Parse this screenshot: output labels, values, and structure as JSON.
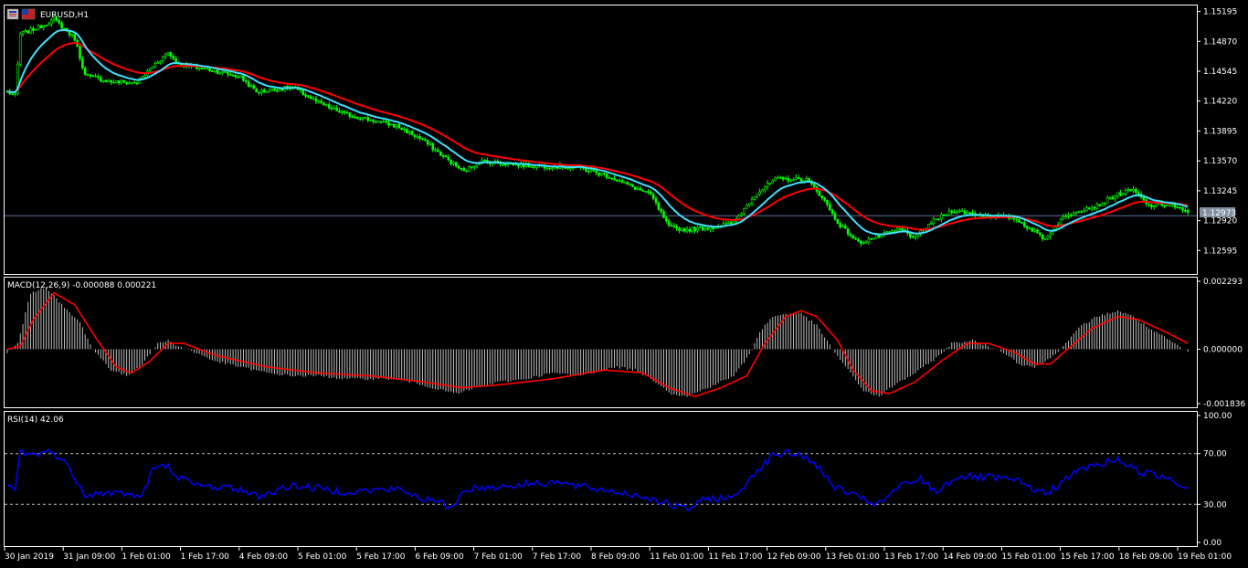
{
  "window": {
    "symbol_label": "EURUSD,H1",
    "macd_label": "MACD(12,26,9) -0.000088 0.000221",
    "rsi_label": "RSI(14) 42.06",
    "current_price": "1.12973"
  },
  "colors": {
    "background": "#000000",
    "frame": "#ffffff",
    "candle": "#00ff00",
    "ma_fast": "#40e0ff",
    "ma_slow": "#ff0000",
    "macd_hist": "#c0c0c0",
    "macd_signal": "#ff0000",
    "rsi_line": "#0000ff",
    "price_line": "#6070a0",
    "level_line": "#c0c0c0",
    "price_tag_bg": "#8090a0"
  },
  "chart_data": [
    {
      "type": "candlestick",
      "symbol": "EURUSD",
      "timeframe": "H1",
      "y_ticks": [
        "1.15195",
        "1.14870",
        "1.14545",
        "1.14220",
        "1.13895",
        "1.13570",
        "1.13245",
        "1.12920",
        "1.12595"
      ],
      "ylim": [
        1.1234,
        1.1526
      ],
      "current_price": 1.12973,
      "close_keypoints": [
        [
          0,
          1.1432
        ],
        [
          3,
          1.1428
        ],
        [
          5,
          1.1495
        ],
        [
          12,
          1.1502
        ],
        [
          18,
          1.1511
        ],
        [
          23,
          1.1498
        ],
        [
          26,
          1.149
        ],
        [
          30,
          1.145
        ],
        [
          40,
          1.1443
        ],
        [
          50,
          1.1442
        ],
        [
          56,
          1.146
        ],
        [
          62,
          1.1475
        ],
        [
          66,
          1.1462
        ],
        [
          80,
          1.1455
        ],
        [
          90,
          1.1448
        ],
        [
          96,
          1.1432
        ],
        [
          110,
          1.1437
        ],
        [
          120,
          1.142
        ],
        [
          130,
          1.1408
        ],
        [
          150,
          1.1395
        ],
        [
          160,
          1.138
        ],
        [
          168,
          1.1362
        ],
        [
          176,
          1.1345
        ],
        [
          182,
          1.1357
        ],
        [
          200,
          1.1352
        ],
        [
          220,
          1.135
        ],
        [
          232,
          1.134
        ],
        [
          248,
          1.132
        ],
        [
          255,
          1.1285
        ],
        [
          262,
          1.1282
        ],
        [
          272,
          1.1285
        ],
        [
          280,
          1.129
        ],
        [
          288,
          1.132
        ],
        [
          296,
          1.1337
        ],
        [
          308,
          1.1337
        ],
        [
          314,
          1.1318
        ],
        [
          320,
          1.129
        ],
        [
          328,
          1.1268
        ],
        [
          336,
          1.1275
        ],
        [
          344,
          1.1283
        ],
        [
          350,
          1.1273
        ],
        [
          356,
          1.129
        ],
        [
          364,
          1.1303
        ],
        [
          376,
          1.1298
        ],
        [
          388,
          1.1295
        ],
        [
          396,
          1.128
        ],
        [
          400,
          1.1272
        ],
        [
          406,
          1.1293
        ],
        [
          412,
          1.1303
        ],
        [
          420,
          1.1308
        ],
        [
          428,
          1.1321
        ],
        [
          434,
          1.1325
        ],
        [
          440,
          1.1308
        ],
        [
          448,
          1.131
        ],
        [
          455,
          1.13
        ]
      ],
      "series": [
        {
          "name": "",
          "kind": "moving-average-fast"
        },
        {
          "name": "",
          "kind": "moving-average-slow"
        }
      ]
    },
    {
      "type": "macd",
      "title": "MACD(12,26,9) -0.000088 0.000221",
      "y_ticks": [
        "0.002293",
        "0.000000",
        "-0.001836"
      ],
      "ylim": [
        -0.001836,
        0.002293
      ],
      "hist_keypoints": [
        [
          0,
          -0.0001
        ],
        [
          4,
          0.0002
        ],
        [
          9,
          0.0019
        ],
        [
          15,
          0.0021
        ],
        [
          22,
          0.0014
        ],
        [
          28,
          0.0009
        ],
        [
          33,
          0.0
        ],
        [
          40,
          -0.0007
        ],
        [
          46,
          -0.0009
        ],
        [
          52,
          -0.0005
        ],
        [
          58,
          0.0002
        ],
        [
          62,
          0.0003
        ],
        [
          66,
          0.0001
        ],
        [
          72,
          -0.0001
        ],
        [
          80,
          -0.0004
        ],
        [
          90,
          -0.0006
        ],
        [
          100,
          -0.0008
        ],
        [
          110,
          -0.0009
        ],
        [
          120,
          -0.0009
        ],
        [
          130,
          -0.001
        ],
        [
          140,
          -0.001
        ],
        [
          150,
          -0.001
        ],
        [
          160,
          -0.0012
        ],
        [
          168,
          -0.0014
        ],
        [
          174,
          -0.0015
        ],
        [
          180,
          -0.0013
        ],
        [
          190,
          -0.0011
        ],
        [
          200,
          -0.001
        ],
        [
          210,
          -0.0008
        ],
        [
          220,
          -0.0009
        ],
        [
          235,
          -0.0006
        ],
        [
          242,
          -0.0007
        ],
        [
          250,
          -0.0011
        ],
        [
          256,
          -0.0015
        ],
        [
          262,
          -0.0016
        ],
        [
          270,
          -0.0013
        ],
        [
          280,
          -0.0009
        ],
        [
          286,
          -0.0002
        ],
        [
          290,
          0.0006
        ],
        [
          295,
          0.0011
        ],
        [
          300,
          0.0012
        ],
        [
          306,
          0.0012
        ],
        [
          312,
          0.0008
        ],
        [
          318,
          0.0
        ],
        [
          324,
          -0.0007
        ],
        [
          330,
          -0.0014
        ],
        [
          336,
          -0.0016
        ],
        [
          342,
          -0.0012
        ],
        [
          350,
          -0.0008
        ],
        [
          358,
          -0.0003
        ],
        [
          364,
          0.0002
        ],
        [
          372,
          0.0003
        ],
        [
          378,
          0.0001
        ],
        [
          384,
          -0.0001
        ],
        [
          390,
          -0.0005
        ],
        [
          396,
          -0.0006
        ],
        [
          402,
          -0.0003
        ],
        [
          408,
          0.0002
        ],
        [
          414,
          0.0008
        ],
        [
          420,
          0.0011
        ],
        [
          428,
          0.0013
        ],
        [
          434,
          0.0011
        ],
        [
          440,
          0.0007
        ],
        [
          448,
          0.0003
        ],
        [
          455,
          -0.0001
        ]
      ],
      "signal_keypoints": [
        [
          0,
          0.0
        ],
        [
          5,
          0.0001
        ],
        [
          10,
          0.001
        ],
        [
          18,
          0.0019
        ],
        [
          26,
          0.0015
        ],
        [
          34,
          0.0004
        ],
        [
          42,
          -0.0006
        ],
        [
          48,
          -0.0008
        ],
        [
          55,
          -0.0004
        ],
        [
          62,
          0.0002
        ],
        [
          68,
          0.0002
        ],
        [
          80,
          -0.0002
        ],
        [
          100,
          -0.0006
        ],
        [
          120,
          -0.0008
        ],
        [
          140,
          -0.0009
        ],
        [
          160,
          -0.0011
        ],
        [
          175,
          -0.0013
        ],
        [
          190,
          -0.0012
        ],
        [
          210,
          -0.001
        ],
        [
          230,
          -0.0007
        ],
        [
          245,
          -0.0008
        ],
        [
          255,
          -0.0013
        ],
        [
          265,
          -0.0016
        ],
        [
          275,
          -0.0013
        ],
        [
          285,
          -0.0009
        ],
        [
          292,
          0.0002
        ],
        [
          300,
          0.0011
        ],
        [
          306,
          0.0013
        ],
        [
          312,
          0.0011
        ],
        [
          320,
          0.0003
        ],
        [
          326,
          -0.0007
        ],
        [
          333,
          -0.0014
        ],
        [
          340,
          -0.0015
        ],
        [
          350,
          -0.0011
        ],
        [
          360,
          -0.0004
        ],
        [
          370,
          0.0002
        ],
        [
          378,
          0.0002
        ],
        [
          388,
          -0.0001
        ],
        [
          396,
          -0.0005
        ],
        [
          402,
          -0.0005
        ],
        [
          410,
          0.0001
        ],
        [
          418,
          0.0007
        ],
        [
          428,
          0.0011
        ],
        [
          436,
          0.001
        ],
        [
          446,
          0.0006
        ],
        [
          455,
          0.0002
        ]
      ]
    },
    {
      "type": "line",
      "title": "RSI(14) 42.06",
      "y_ticks": [
        "100.00",
        "70.00",
        "30.00",
        "0.00"
      ],
      "ylim": [
        0,
        100
      ],
      "levels": [
        70,
        30
      ],
      "values_keypoints": [
        [
          0,
          45
        ],
        [
          3,
          42
        ],
        [
          5,
          71
        ],
        [
          10,
          69
        ],
        [
          15,
          72
        ],
        [
          20,
          68
        ],
        [
          25,
          55
        ],
        [
          30,
          38
        ],
        [
          40,
          39
        ],
        [
          48,
          38
        ],
        [
          52,
          36
        ],
        [
          56,
          58
        ],
        [
          62,
          60
        ],
        [
          66,
          52
        ],
        [
          72,
          45
        ],
        [
          80,
          44
        ],
        [
          90,
          42
        ],
        [
          96,
          36
        ],
        [
          110,
          45
        ],
        [
          130,
          40
        ],
        [
          150,
          42
        ],
        [
          160,
          35
        ],
        [
          168,
          30
        ],
        [
          172,
          28
        ],
        [
          176,
          42
        ],
        [
          190,
          44
        ],
        [
          210,
          48
        ],
        [
          220,
          44
        ],
        [
          235,
          40
        ],
        [
          248,
          35
        ],
        [
          255,
          30
        ],
        [
          262,
          26
        ],
        [
          270,
          35
        ],
        [
          280,
          35
        ],
        [
          288,
          55
        ],
        [
          296,
          70
        ],
        [
          304,
          70
        ],
        [
          310,
          65
        ],
        [
          318,
          45
        ],
        [
          328,
          35
        ],
        [
          336,
          30
        ],
        [
          344,
          44
        ],
        [
          352,
          50
        ],
        [
          358,
          40
        ],
        [
          366,
          52
        ],
        [
          378,
          51
        ],
        [
          388,
          49
        ],
        [
          396,
          42
        ],
        [
          400,
          38
        ],
        [
          406,
          47
        ],
        [
          414,
          58
        ],
        [
          422,
          62
        ],
        [
          428,
          66
        ],
        [
          434,
          58
        ],
        [
          440,
          54
        ],
        [
          448,
          51
        ],
        [
          455,
          42
        ]
      ]
    }
  ],
  "x_axis": {
    "labels": [
      "30 Jan 2019",
      "31 Jan 09:00",
      "1 Feb 01:00",
      "1 Feb 17:00",
      "4 Feb 09:00",
      "5 Feb 01:00",
      "5 Feb 17:00",
      "6 Feb 09:00",
      "7 Feb 01:00",
      "7 Feb 17:00",
      "8 Feb 09:00",
      "11 Feb 01:00",
      "11 Feb 17:00",
      "12 Feb 09:00",
      "13 Feb 01:00",
      "13 Feb 17:00",
      "14 Feb 09:00",
      "15 Feb 01:00",
      "15 Feb 17:00",
      "18 Feb 09:00",
      "19 Feb 01:00"
    ]
  }
}
